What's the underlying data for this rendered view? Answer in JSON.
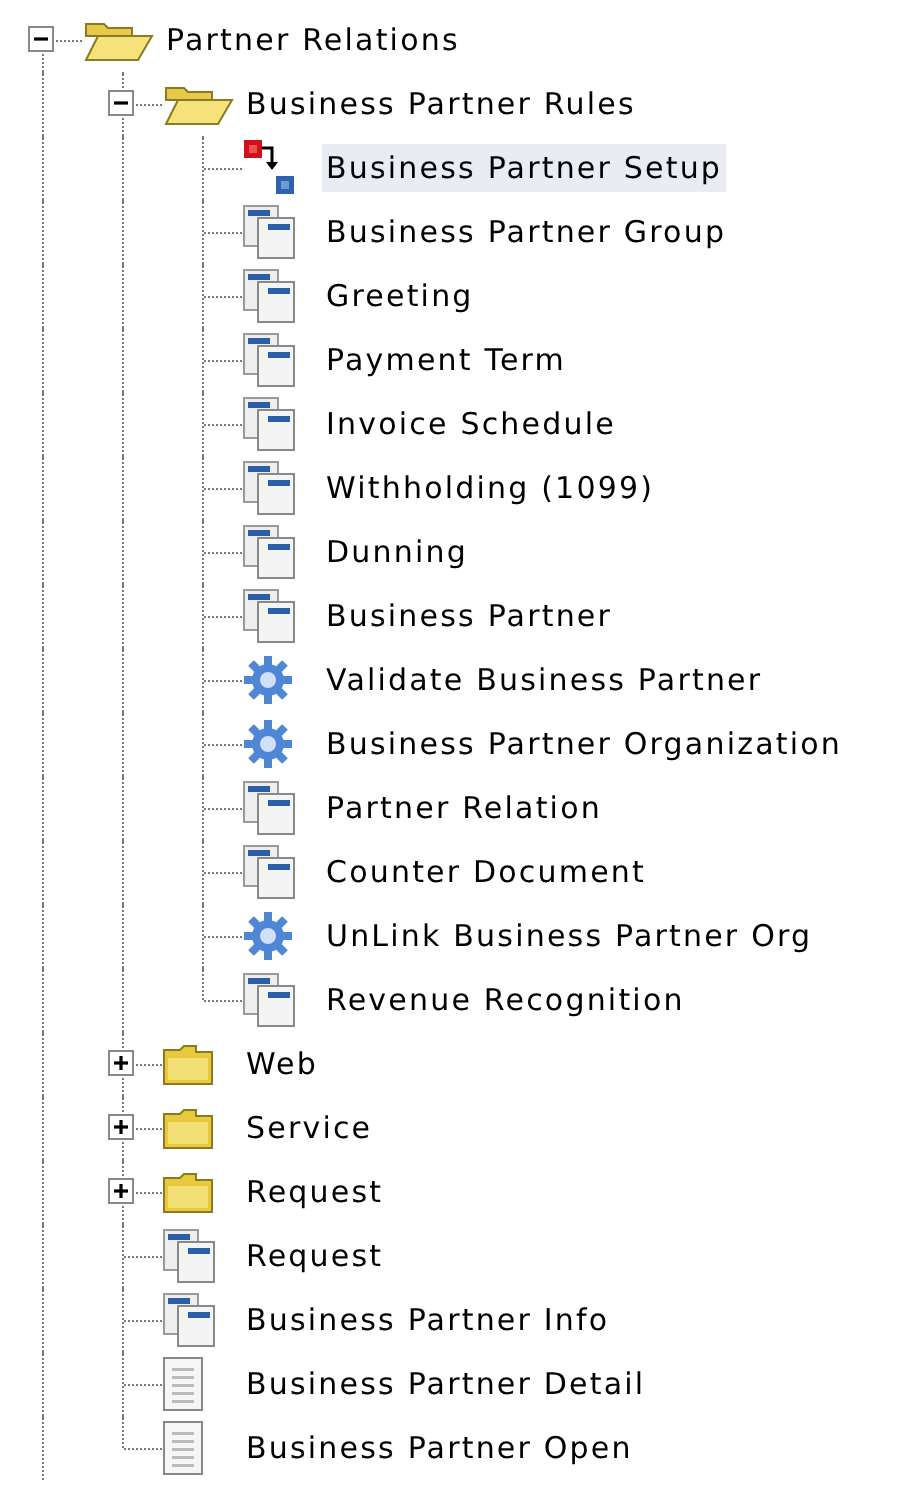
{
  "tree": [
    {
      "label": "Partner Relations",
      "kind": "folder",
      "expanded": true,
      "selected": false,
      "children": [
        {
          "label": "Business Partner Rules",
          "kind": "folder",
          "expanded": true,
          "selected": false,
          "children": [
            {
              "label": "Business Partner Setup",
              "kind": "workflow",
              "selected": true
            },
            {
              "label": "Business Partner Group",
              "kind": "window",
              "selected": false
            },
            {
              "label": "Greeting",
              "kind": "window",
              "selected": false
            },
            {
              "label": "Payment Term",
              "kind": "window",
              "selected": false
            },
            {
              "label": "Invoice Schedule",
              "kind": "window",
              "selected": false
            },
            {
              "label": "Withholding (1099)",
              "kind": "window",
              "selected": false
            },
            {
              "label": "Dunning",
              "kind": "window",
              "selected": false
            },
            {
              "label": "Business Partner",
              "kind": "window",
              "selected": false
            },
            {
              "label": "Validate Business Partner",
              "kind": "process",
              "selected": false
            },
            {
              "label": "Business Partner Organization",
              "kind": "process",
              "selected": false
            },
            {
              "label": "Partner Relation",
              "kind": "window",
              "selected": false
            },
            {
              "label": "Counter Document",
              "kind": "window",
              "selected": false
            },
            {
              "label": "UnLink Business Partner Org",
              "kind": "process",
              "selected": false
            },
            {
              "label": "Revenue Recognition",
              "kind": "window",
              "selected": false
            }
          ]
        },
        {
          "label": "Web",
          "kind": "folder",
          "expanded": false,
          "selected": false
        },
        {
          "label": "Service",
          "kind": "folder",
          "expanded": false,
          "selected": false
        },
        {
          "label": "Request",
          "kind": "folder",
          "expanded": false,
          "selected": false
        },
        {
          "label": "Request",
          "kind": "window",
          "selected": false
        },
        {
          "label": "Business Partner Info",
          "kind": "window",
          "selected": false
        },
        {
          "label": "Business Partner Detail",
          "kind": "report",
          "selected": false
        },
        {
          "label": "Business Partner Open",
          "kind": "report",
          "selected": false
        }
      ]
    }
  ]
}
